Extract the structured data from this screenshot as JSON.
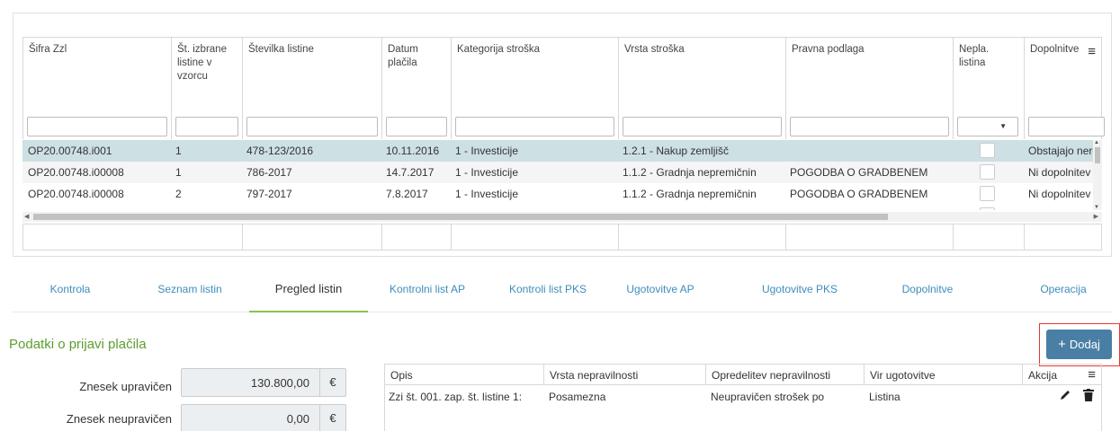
{
  "grid": {
    "columns": [
      {
        "label": "Šifra Zzl"
      },
      {
        "label": "Št. izbrane\nlistine v\nvzorcu"
      },
      {
        "label": "Številka listine"
      },
      {
        "label": "Datum\nplačila"
      },
      {
        "label": "Kategorija stroška"
      },
      {
        "label": "Vrsta stroška"
      },
      {
        "label": "Pravna podlaga"
      },
      {
        "label": "Nepla.\nlistina"
      },
      {
        "label": "Dopolnitve"
      }
    ],
    "rows": [
      {
        "sifra": "OP20.00748.i001",
        "st": "1",
        "stevilka": "478-123/2016",
        "datum": "10.11.2016",
        "kategorija": "1 - Investicije",
        "vrsta": "1.2.1 - Nakup zemljišč",
        "pravna": "",
        "dopolnitve": "Obstajajo nerešene"
      },
      {
        "sifra": "OP20.00748.i00008",
        "st": "1",
        "stevilka": "786-2017",
        "datum": "14.7.2017",
        "kategorija": "1 - Investicije",
        "vrsta": "1.1.2 - Gradnja nepremičnin",
        "pravna": "POGODBA O GRADBENEM",
        "dopolnitve": "Ni dopolnitev"
      },
      {
        "sifra": "OP20.00748.i00008",
        "st": "2",
        "stevilka": "797-2017",
        "datum": "7.8.2017",
        "kategorija": "1 - Investicije",
        "vrsta": "1.1.2 - Gradnja nepremičnin",
        "pravna": "POGODBA O GRADBENEM",
        "dopolnitve": "Ni dopolnitev"
      }
    ]
  },
  "tabs": [
    {
      "label": "Kontrola"
    },
    {
      "label": "Seznam listin"
    },
    {
      "label": "Pregled listin"
    },
    {
      "label": "Kontrolni list AP"
    },
    {
      "label": "Kontroli list PKS"
    },
    {
      "label": "Ugotovitve AP"
    },
    {
      "label": "Ugotovitve PKS"
    },
    {
      "label": "Dopolnitve"
    },
    {
      "label": "Operacija"
    }
  ],
  "active_tab": "Pregled listin",
  "section": {
    "title": "Podatki o prijavi plačila",
    "fields": [
      {
        "label": "Znesek upravičen",
        "value": "130.800,00",
        "currency": "€"
      },
      {
        "label": "Znesek neupravičen",
        "value": "0,00",
        "currency": "€"
      }
    ],
    "add_button": "Dodaj",
    "add_icon": "+"
  },
  "irregularities": {
    "columns": [
      {
        "label": "Opis"
      },
      {
        "label": "Vrsta nepravilnosti"
      },
      {
        "label": "Opredelitev nepravilnosti"
      },
      {
        "label": "Vir ugotovitve"
      },
      {
        "label": "Akcija"
      }
    ],
    "rows": [
      {
        "opis": "Zzi št. 001. zap. št. listine 1:",
        "vrsta": "Posamezna",
        "opredelitev": "Neupravičen strošek po",
        "vir": "Listina"
      }
    ]
  },
  "icons": {
    "menu": "menu-icon",
    "edit": "pencil-icon",
    "delete": "trash-icon"
  },
  "colors": {
    "selected_row": "#cde0e4",
    "tab_link": "#3c8dbc",
    "section_title": "#5c9e2f",
    "button": "#4a7fa5",
    "highlight_outline": "#e53935"
  }
}
